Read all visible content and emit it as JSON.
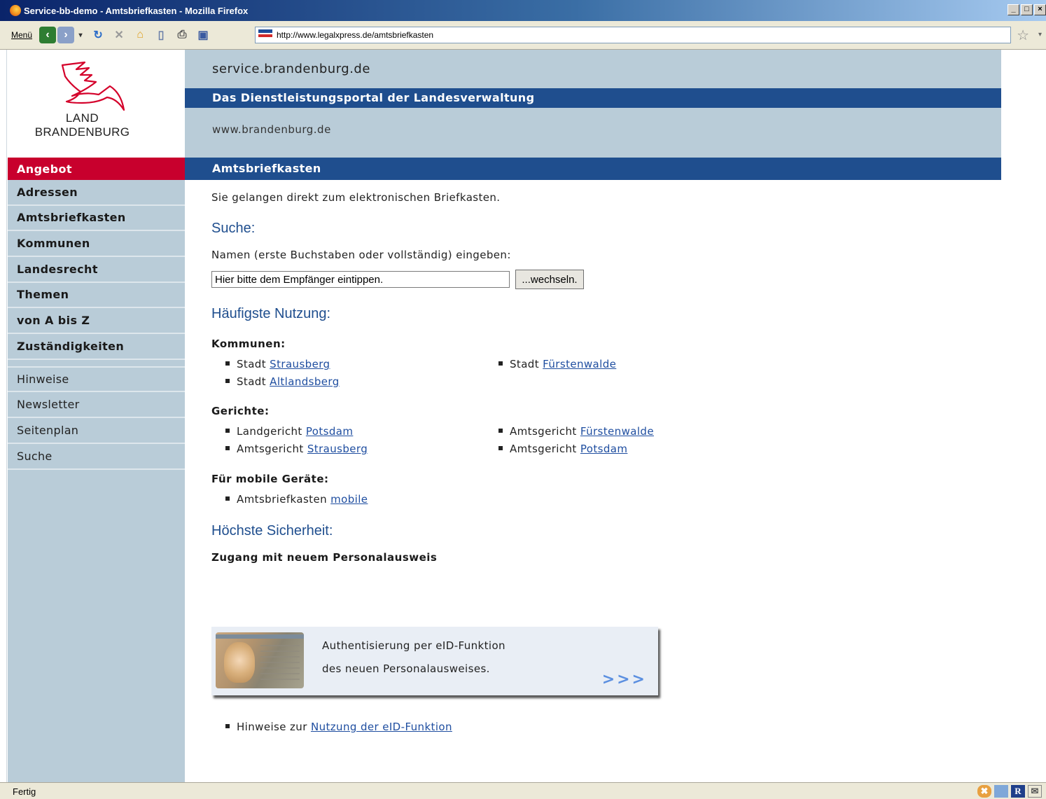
{
  "window": {
    "title": "Service-bb-demo - Amtsbriefkasten - Mozilla Firefox"
  },
  "browser": {
    "menu_label": "Menü",
    "url": "http://www.legalxpress.de/amtsbriefkasten",
    "status": "Fertig"
  },
  "logo": {
    "line1": "LAND",
    "line2": "BRANDENBURG"
  },
  "sidebar": {
    "primary": [
      {
        "label": "Angebot",
        "active": true
      },
      {
        "label": "Adressen"
      },
      {
        "label": "Amtsbriefkasten"
      },
      {
        "label": "Kommunen"
      },
      {
        "label": "Landesrecht"
      },
      {
        "label": "Themen"
      },
      {
        "label": "von A bis Z"
      },
      {
        "label": "Zuständigkeiten"
      }
    ],
    "secondary": [
      {
        "label": "Hinweise"
      },
      {
        "label": "Newsletter"
      },
      {
        "label": "Seitenplan"
      },
      {
        "label": "Suche"
      }
    ]
  },
  "header": {
    "site": "service.brandenburg.de",
    "tagline": "Das Dienstleistungsportal der Landesverwaltung",
    "link": "www.brandenburg.de",
    "section": "Amtsbriefkasten"
  },
  "main": {
    "intro": "Sie gelangen direkt zum elektronischen Briefkasten.",
    "search": {
      "heading": "Suche:",
      "instruction": "Namen (erste Buchstaben oder vollständig) eingeben:",
      "input_value": "Hier bitte dem Empfänger eintippen.",
      "button_label": "...wechseln."
    },
    "usage": {
      "heading": "Häufigste Nutzung:",
      "kommunen": {
        "title": "Kommunen:",
        "items": [
          {
            "prefix": "Stadt",
            "link": "Strausberg"
          },
          {
            "prefix": "Stadt",
            "link": "Fürstenwalde"
          },
          {
            "prefix": "Stadt",
            "link": "Altlandsberg"
          }
        ]
      },
      "gerichte": {
        "title": "Gerichte:",
        "items": [
          {
            "prefix": "Landgericht",
            "link": "Potsdam"
          },
          {
            "prefix": "Amtsgericht",
            "link": "Fürstenwalde"
          },
          {
            "prefix": "Amtsgericht",
            "link": "Strausberg"
          },
          {
            "prefix": "Amtsgericht",
            "link": "Potsdam"
          }
        ]
      },
      "mobile": {
        "title": "Für mobile Geräte:",
        "items": [
          {
            "prefix": "Amtsbriefkasten",
            "link": "mobile"
          }
        ]
      }
    },
    "security": {
      "heading": "Höchste Sicherheit:",
      "subheading": "Zugang mit neuem Personalausweis",
      "card_line1": "Authentisierung per eID-Funktion",
      "card_line2": "des neuen Personalausweises.",
      "card_arrow": ">>>",
      "hint_prefix": "Hinweise zur",
      "hint_link": "Nutzung der eID-Funktion"
    }
  },
  "colors": {
    "sidebar_bg": "#b9ccd8",
    "band_blue": "#1f4e8e",
    "active_red": "#c8002d",
    "link_blue": "#1f4ea0"
  }
}
